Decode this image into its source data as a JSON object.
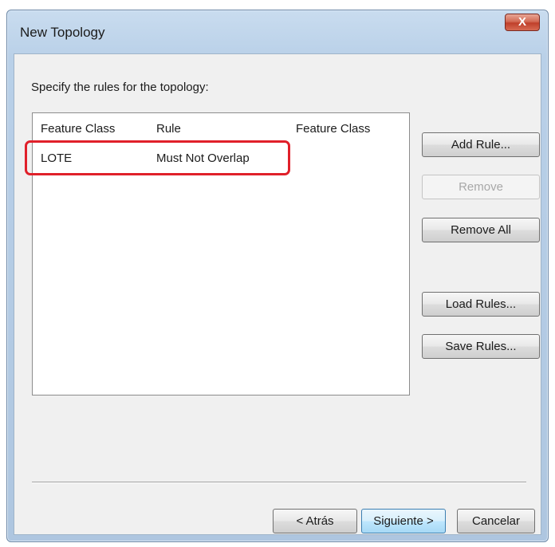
{
  "window": {
    "title": "New Topology",
    "close_label": "X"
  },
  "instruction": "Specify the rules for the topology:",
  "rules_table": {
    "columns": [
      "Feature Class",
      "Rule",
      "Feature Class"
    ],
    "rows": [
      {
        "feature_class": "LOTE",
        "rule": "Must Not Overlap",
        "feature_class_2": ""
      }
    ]
  },
  "side_buttons": {
    "add_rule": "Add Rule...",
    "remove": "Remove",
    "remove_all": "Remove All",
    "load_rules": "Load Rules...",
    "save_rules": "Save Rules..."
  },
  "footer_buttons": {
    "back": "< Atrás",
    "next": "Siguiente >",
    "cancel": "Cancelar"
  },
  "colors": {
    "highlight": "#e0202a",
    "close_button": "#c0402b"
  }
}
